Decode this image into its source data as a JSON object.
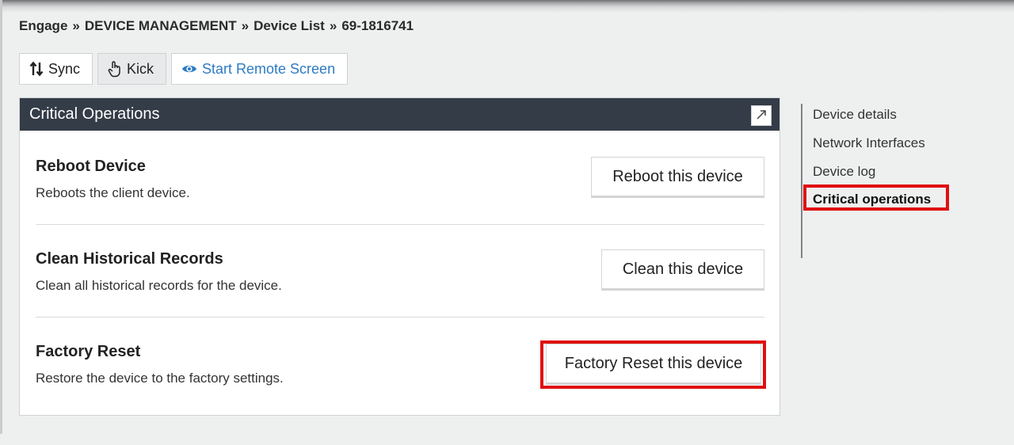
{
  "breadcrumb": {
    "items": [
      "Engage",
      "DEVICE MANAGEMENT",
      "Device List",
      "69-1816741"
    ],
    "separator": "»"
  },
  "toolbar": {
    "sync": {
      "label": "Sync",
      "icon": "sort-arrows-icon"
    },
    "kick": {
      "label": "Kick",
      "icon": "hand-pointer-icon"
    },
    "remote": {
      "label": "Start Remote Screen",
      "icon": "eye-icon"
    }
  },
  "panel": {
    "title": "Critical Operations",
    "expand_icon": "expand-arrow-icon",
    "operations": [
      {
        "title": "Reboot Device",
        "description": "Reboots the client device.",
        "button": "Reboot this device"
      },
      {
        "title": "Clean Historical Records",
        "description": "Clean all historical records for the device.",
        "button": "Clean this device"
      },
      {
        "title": "Factory Reset",
        "description": "Restore the device to the factory settings.",
        "button": "Factory Reset this device"
      }
    ]
  },
  "sidenav": {
    "items": [
      "Device details",
      "Network Interfaces",
      "Device log",
      "Critical operations"
    ],
    "active": "Critical operations"
  },
  "colors": {
    "panel_header": "#343c48",
    "link": "#2d7bc4",
    "highlight": "#e01010",
    "background": "#eef0f0"
  }
}
